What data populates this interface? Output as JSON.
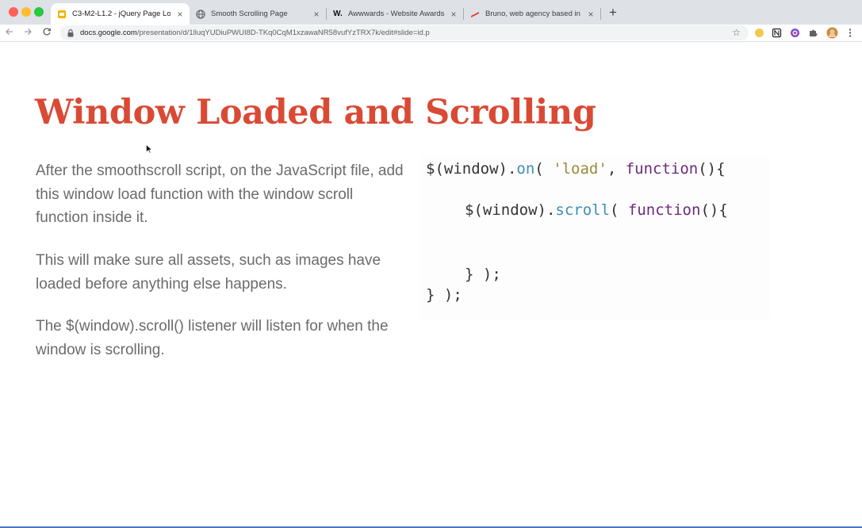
{
  "tabs": [
    {
      "title": "C3-M2-L1.2 - jQuery Page Lo",
      "active": true,
      "favicon": "google-slides-icon"
    },
    {
      "title": "Smooth Scrolling Page",
      "active": false,
      "favicon": "globe-icon"
    },
    {
      "title": "Awwwards - Website Awards -",
      "active": false,
      "favicon": "awwwards-icon",
      "favicon_text": "W."
    },
    {
      "title": "Bruno, web agency based in C",
      "active": false,
      "favicon": "bruno-icon"
    }
  ],
  "toolbar": {
    "url_domain": "docs.google.com",
    "url_path": "/presentation/d/1lluqYUDiuPWUI8D-TKq0CqM1xzawaNR58vufYzTRX7k/edit#slide=id.p"
  },
  "slide": {
    "title": "Window Loaded and Scrolling",
    "paragraphs": [
      "After the smoothscroll script, on the JavaScript file, add this window load function with the window scroll function inside it.",
      "This will make sure all assets, such as images have loaded before anything else happens.",
      "The $(window).scroll() listener will listen for when the window is scrolling."
    ],
    "code": {
      "l1_a": "$(window).",
      "l1_method": "on",
      "l1_b": "( ",
      "l1_string": "'load'",
      "l1_c": ", ",
      "l1_func": "function",
      "l1_d": "(){",
      "l2_a": "$(window).",
      "l2_method": "scroll",
      "l2_b": "( ",
      "l2_func": "function",
      "l2_c": "(){",
      "l3": "} );",
      "l4": "} );"
    }
  },
  "colors": {
    "title": "#d94a35",
    "body_text": "#6b6b6b",
    "code_method": "#3d8fb0",
    "code_string": "#9a8a3a",
    "code_function": "#6b2b7a"
  }
}
